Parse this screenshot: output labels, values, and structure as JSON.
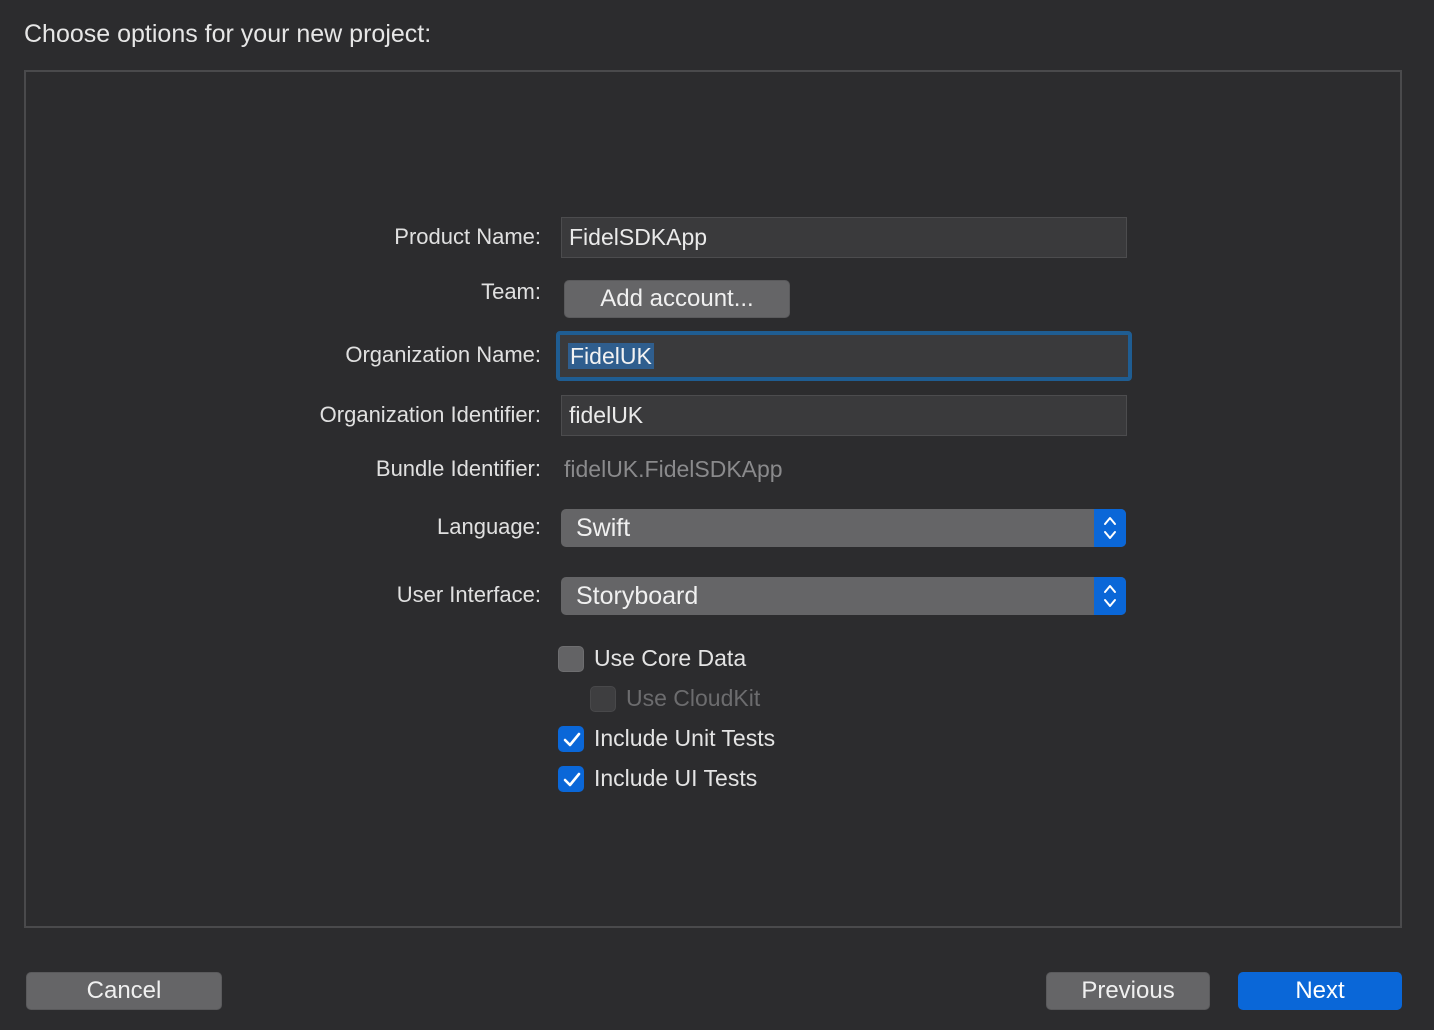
{
  "header": {
    "title": "Choose options for your new project:"
  },
  "form": {
    "product_name": {
      "label": "Product Name:",
      "value": "FidelSDKApp"
    },
    "team": {
      "label": "Team:",
      "button_label": "Add account..."
    },
    "organization_name": {
      "label": "Organization Name:",
      "value": "FidelUK"
    },
    "organization_identifier": {
      "label": "Organization Identifier:",
      "value": "fidelUK"
    },
    "bundle_identifier": {
      "label": "Bundle Identifier:",
      "value": "fidelUK.FidelSDKApp"
    },
    "language": {
      "label": "Language:",
      "selected": "Swift"
    },
    "user_interface": {
      "label": "User Interface:",
      "selected": "Storyboard"
    },
    "options": [
      {
        "label": "Use Core Data",
        "checked": false,
        "enabled": true
      },
      {
        "label": "Use CloudKit",
        "checked": false,
        "enabled": false
      },
      {
        "label": "Include Unit Tests",
        "checked": true,
        "enabled": true
      },
      {
        "label": "Include UI Tests",
        "checked": true,
        "enabled": true
      }
    ]
  },
  "footer": {
    "cancel_label": "Cancel",
    "previous_label": "Previous",
    "next_label": "Next"
  },
  "colors": {
    "background": "#2c2c2e",
    "accent": "#0a67d8",
    "focus_ring": "#1f5d92"
  }
}
